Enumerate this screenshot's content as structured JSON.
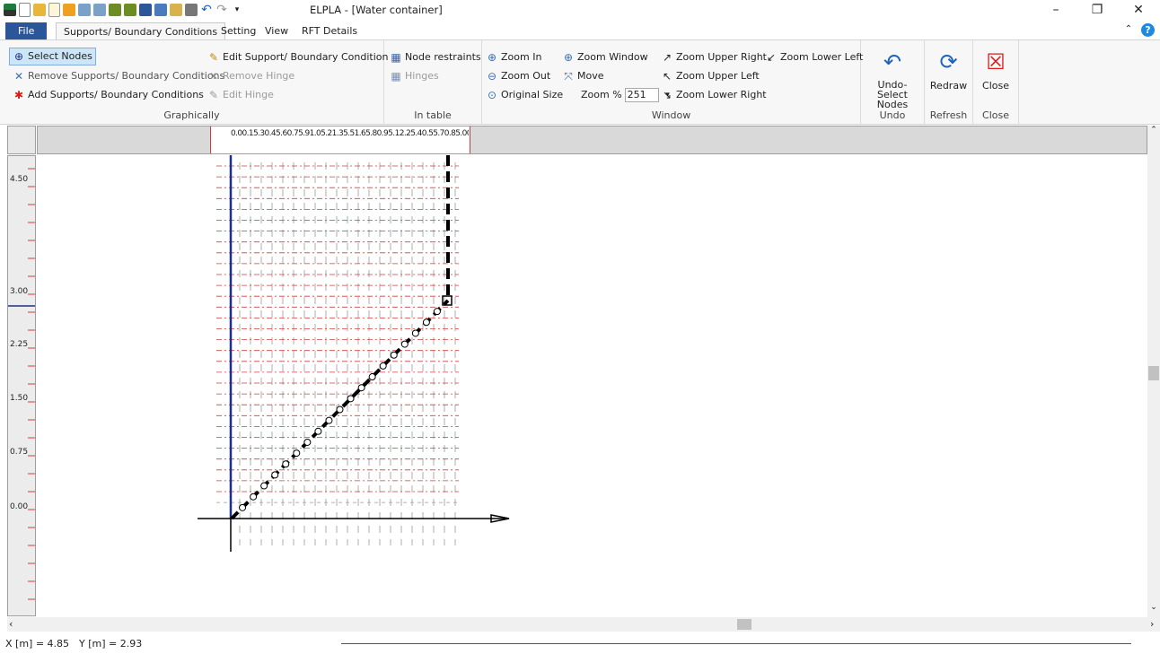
{
  "window": {
    "title": "ELPLA - [Water container]",
    "minimize": "–",
    "restore": "❐",
    "close": "✕"
  },
  "tabs": [
    {
      "label": "File"
    },
    {
      "label": "Supports/ Boundary Conditions"
    },
    {
      "label": "Setting"
    },
    {
      "label": "View"
    },
    {
      "label": "RFT Details"
    }
  ],
  "ribbon": {
    "graphically": {
      "label": "Graphically",
      "select_nodes": "Select Nodes",
      "remove_supports": "Remove Supports/ Boundary Conditions",
      "add_supports": "Add Supports/ Boundary Conditions",
      "edit_support": "Edit Support/ Boundary Condition",
      "remove_hinge": "Remove Hinge",
      "edit_hinge": "Edit Hinge"
    },
    "in_table": {
      "label": "In table",
      "node_restraints": "Node restraints",
      "hinges": "Hinges"
    },
    "window": {
      "label": "Window",
      "zoom_in": "Zoom In",
      "zoom_out": "Zoom Out",
      "original_size": "Original Size",
      "zoom_window": "Zoom Window",
      "move": "Move",
      "zoom_percent_label": "Zoom %",
      "zoom_percent_value": "251",
      "zoom_upper_right": "Zoom Upper Right",
      "zoom_upper_left": "Zoom Upper Left",
      "zoom_lower_right": "Zoom Lower Right",
      "zoom_lower_left": "Zoom Lower Left"
    },
    "undo": {
      "label": "Undo",
      "button": "Undo-Select Nodes"
    },
    "refresh": {
      "label": "Refresh",
      "button": "Redraw"
    },
    "close": {
      "label": "Close",
      "button": "Close"
    }
  },
  "rulers": {
    "horizontal_labels": "0.00.15.30.45.60.75.91.05.21.35.51.65.80.95.12.25.40.55.70.85.00",
    "vertical": [
      "4.50",
      "3.00",
      "2.25",
      "1.50",
      "0.75",
      "0.00"
    ]
  },
  "status": {
    "x_label": "X [m] = 4.85",
    "y_label": "Y [m] = 2.93"
  },
  "colors": {
    "accent": "#2b579a",
    "grid_red": "#d83a3a",
    "structure_blue": "#1f2e8a",
    "help_blue": "#1e88e5"
  }
}
